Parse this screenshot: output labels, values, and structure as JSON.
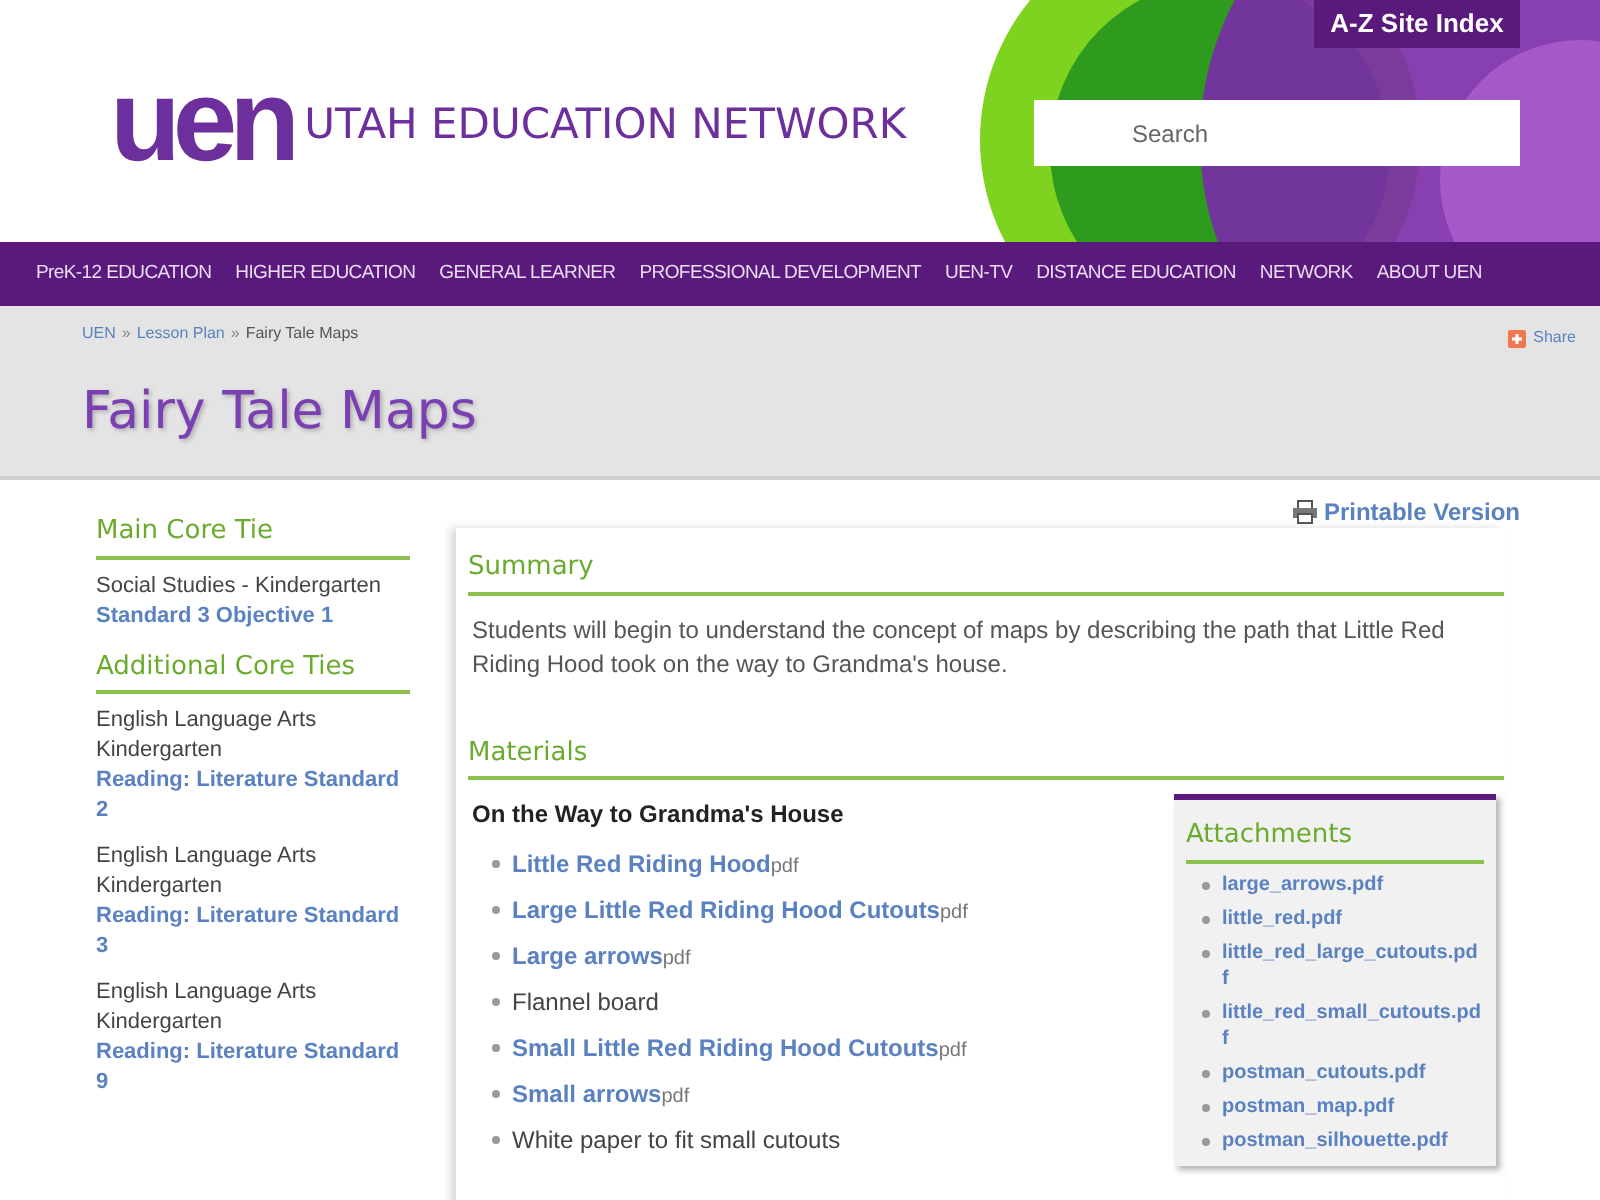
{
  "header": {
    "logo_text": "uen",
    "site_name": "UTAH EDUCATION NETWORK",
    "az_index": "A-Z Site Index",
    "search": {
      "placeholder": "Search"
    }
  },
  "nav": [
    "PreK-12 EDUCATION",
    "HIGHER EDUCATION",
    "GENERAL LEARNER",
    "PROFESSIONAL DEVELOPMENT",
    "UEN-TV",
    "DISTANCE EDUCATION",
    "NETWORK",
    "ABOUT UEN"
  ],
  "breadcrumb": [
    {
      "label": "UEN",
      "link": true
    },
    {
      "label": "Lesson Plan",
      "link": true
    },
    {
      "label": "Fairy Tale Maps",
      "link": false
    }
  ],
  "breadcrumb_separator": "»",
  "share": "Share",
  "page_title": "Fairy Tale Maps",
  "printable": "Printable Version",
  "sidebar": [
    {
      "heading": "Main Core Tie",
      "ties": [
        {
          "subject": "Social Studies - Kindergarten",
          "standard": "Standard 3 Objective 1"
        }
      ]
    },
    {
      "heading": "Additional Core Ties",
      "ties": [
        {
          "subject": "English Language Arts Kindergarten",
          "standard": "Reading: Literature Standard 2"
        },
        {
          "subject": "English Language Arts Kindergarten",
          "standard": "Reading: Literature Standard 3"
        },
        {
          "subject": "English Language Arts Kindergarten",
          "standard": "Reading: Literature Standard 9"
        }
      ]
    }
  ],
  "summary": {
    "heading": "Summary",
    "text": "Students will begin to understand the concept of maps by describing the path that Little Red Riding Hood took on the way to Grandma's house."
  },
  "materials": {
    "heading": "Materials",
    "subheading": "On the Way to Grandma's House",
    "items": [
      {
        "label": "Little Red Riding Hood",
        "suffix": "pdf",
        "link": true
      },
      {
        "label": "Large Little Red Riding Hood Cutouts",
        "suffix": "pdf",
        "link": true
      },
      {
        "label": "Large arrows",
        "suffix": "pdf",
        "link": true
      },
      {
        "label": "Flannel board",
        "link": false
      },
      {
        "label": "Small Little Red Riding Hood Cutouts",
        "suffix": "pdf",
        "link": true
      },
      {
        "label": "Small arrows",
        "suffix": "pdf",
        "link": true
      },
      {
        "label": "White paper to fit small cutouts",
        "link": false
      }
    ]
  },
  "attachments": {
    "heading": "Attachments",
    "files": [
      "large_arrows.pdf",
      "little_red.pdf",
      "little_red_large_cutouts.pdf",
      "little_red_small_cutouts.pdf",
      "postman_cutouts.pdf",
      "postman_map.pdf",
      "postman_silhouette.pdf"
    ]
  }
}
